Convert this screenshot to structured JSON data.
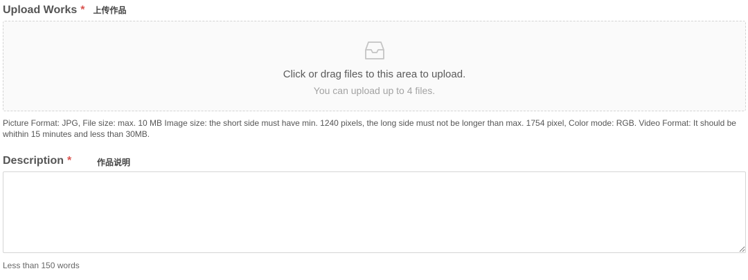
{
  "upload": {
    "label": "Upload Works",
    "required_mark": "*",
    "label_cn": "上传作品",
    "icon": "inbox-icon",
    "dropzone_text": "Click or drag files to this area to upload.",
    "dropzone_hint": "You can upload up to 4 files.",
    "format_info": "Picture Format: JPG,  File size: max. 10 MB Image size: the short side must have min. 1240 pixels, the long side must not be longer than max. 1754 pixel, Color mode: RGB. Video Format: It should be whithin 15 minutes and less than 30MB."
  },
  "description": {
    "label": "Description",
    "required_mark": "*",
    "label_cn": "作品说明",
    "value": "",
    "word_limit": "Less than 150 words"
  },
  "colors": {
    "required": "#d9534f",
    "dropzone_border": "#d3d3d3",
    "dropzone_bg": "#fafafa"
  }
}
